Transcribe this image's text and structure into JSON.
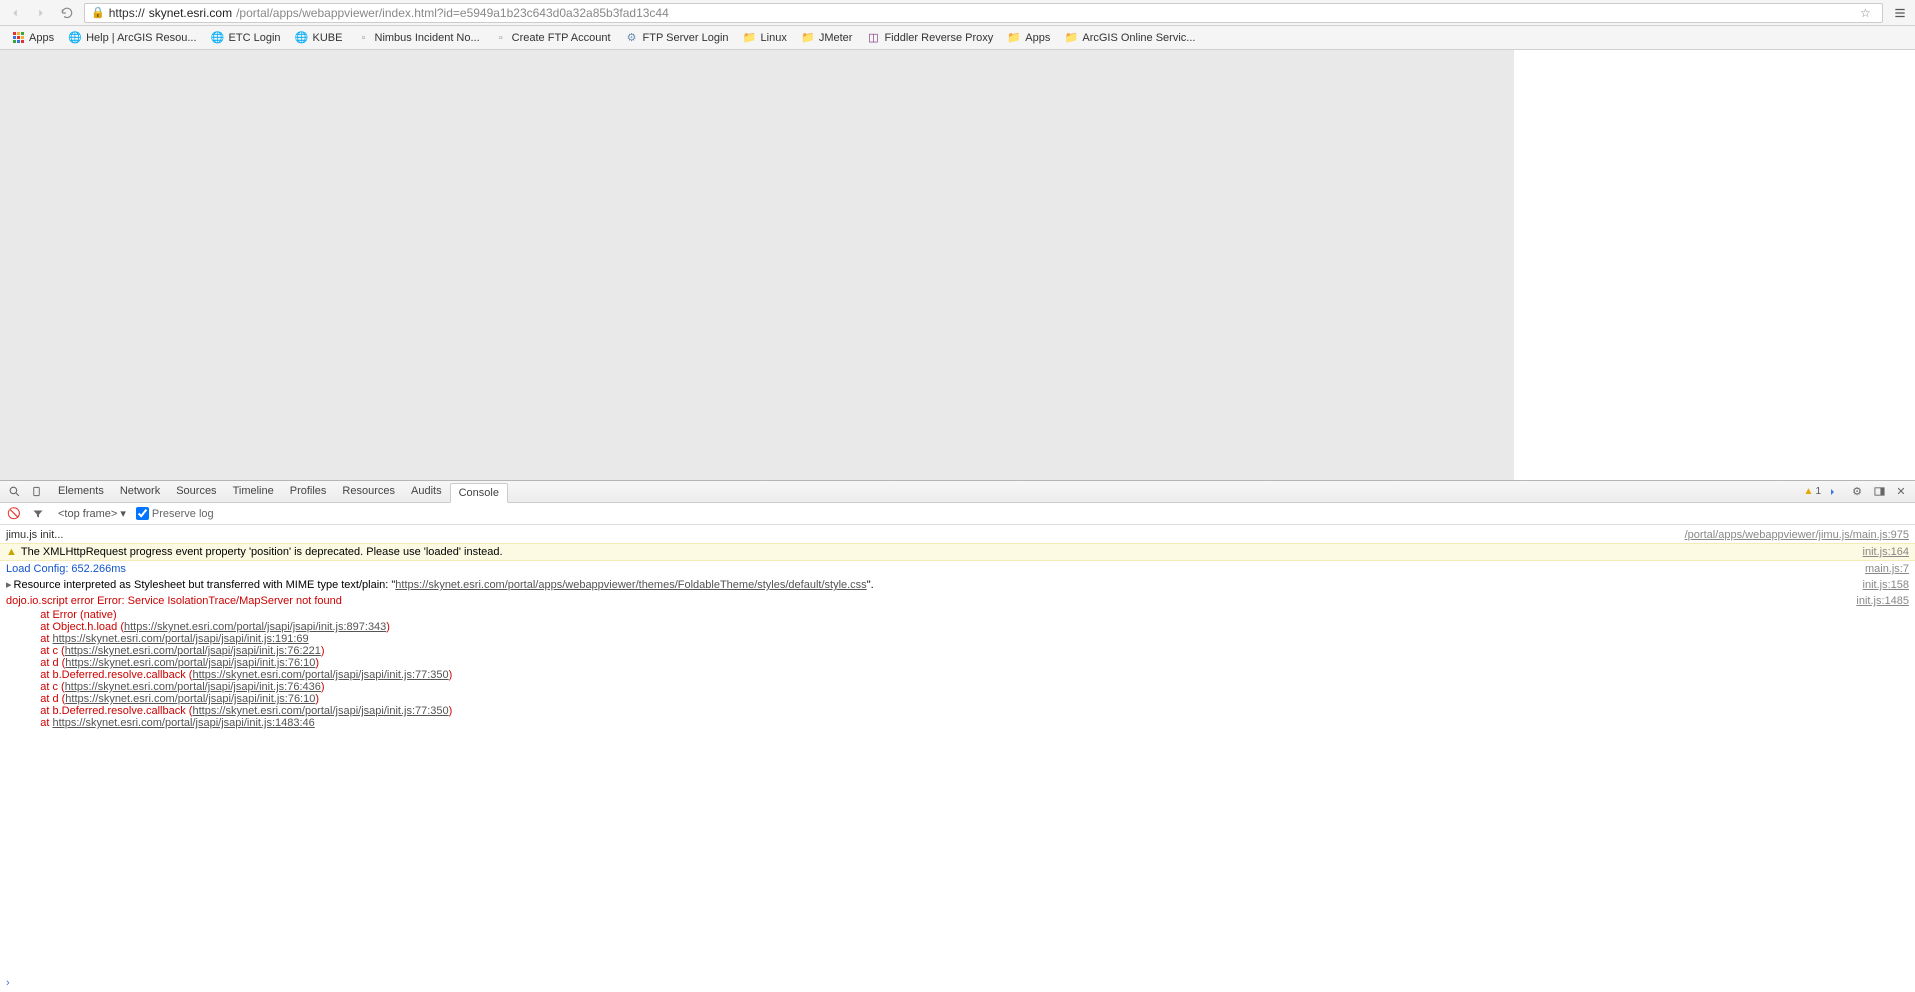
{
  "browser": {
    "url_scheme": "https://",
    "url_domain": "skynet.esri.com",
    "url_path": "/portal/apps/webappviewer/index.html?id=e5949a1b23c643d0a32a85b3fad13c44"
  },
  "bookmarks": [
    {
      "label": "Apps",
      "icon": "apps"
    },
    {
      "label": "Help | ArcGIS Resou...",
      "icon": "globe"
    },
    {
      "label": "ETC Login",
      "icon": "globe"
    },
    {
      "label": "KUBE",
      "icon": "globe"
    },
    {
      "label": "Nimbus Incident No...",
      "icon": "page"
    },
    {
      "label": "Create FTP Account",
      "icon": "page"
    },
    {
      "label": "FTP Server Login",
      "icon": "gear"
    },
    {
      "label": "Linux",
      "icon": "folder"
    },
    {
      "label": "JMeter",
      "icon": "folder"
    },
    {
      "label": "Fiddler Reverse Proxy",
      "icon": "note"
    },
    {
      "label": "Apps",
      "icon": "folder"
    },
    {
      "label": "ArcGIS Online Servic...",
      "icon": "folder"
    }
  ],
  "devtools": {
    "tabs": [
      "Elements",
      "Network",
      "Sources",
      "Timeline",
      "Profiles",
      "Resources",
      "Audits",
      "Console"
    ],
    "active_tab": "Console",
    "warning_count": "1",
    "frame_label": "<top frame>",
    "preserve_log_label": "Preserve log",
    "preserve_log_checked": true
  },
  "console": {
    "lines": [
      {
        "type": "info",
        "text": "jimu.js init...",
        "src": "/portal/apps/webappviewer/jimu.js/main.js:975"
      },
      {
        "type": "warn",
        "text": "The XMLHttpRequest progress event property 'position' is deprecated. Please use 'loaded' instead.",
        "src": "init.js:164"
      },
      {
        "type": "debug",
        "text": "Load Config: 652.266ms",
        "src": "main.js:7"
      },
      {
        "type": "res",
        "text_prefix": "Resource interpreted as Stylesheet but transferred with MIME type text/plain: \"",
        "link": "https://skynet.esri.com/portal/apps/webappviewer/themes/FoldableTheme/styles/default/style.css",
        "text_suffix": "\".",
        "src": "init.js:158"
      }
    ],
    "error": {
      "head": "dojo.io.script error Error: Service IsolationTrace/MapServer not found",
      "src": "init.js:1485",
      "stack": [
        {
          "pre": "    at Error (native)"
        },
        {
          "pre": "    at Object.h.load (",
          "link": "https://skynet.esri.com/portal/jsapi/jsapi/init.js:897:343",
          "post": ")"
        },
        {
          "pre": "    at ",
          "link": "https://skynet.esri.com/portal/jsapi/jsapi/init.js:191:69",
          "post": ""
        },
        {
          "pre": "    at c (",
          "link": "https://skynet.esri.com/portal/jsapi/jsapi/init.js:76:221",
          "post": ")"
        },
        {
          "pre": "    at d (",
          "link": "https://skynet.esri.com/portal/jsapi/jsapi/init.js:76:10",
          "post": ")"
        },
        {
          "pre": "    at b.Deferred.resolve.callback (",
          "link": "https://skynet.esri.com/portal/jsapi/jsapi/init.js:77:350",
          "post": ")"
        },
        {
          "pre": "    at c (",
          "link": "https://skynet.esri.com/portal/jsapi/jsapi/init.js:76:436",
          "post": ")"
        },
        {
          "pre": "    at d (",
          "link": "https://skynet.esri.com/portal/jsapi/jsapi/init.js:76:10",
          "post": ")"
        },
        {
          "pre": "    at b.Deferred.resolve.callback (",
          "link": "https://skynet.esri.com/portal/jsapi/jsapi/init.js:77:350",
          "post": ")"
        },
        {
          "pre": "    at ",
          "link": "https://skynet.esri.com/portal/jsapi/jsapi/init.js:1483:46",
          "post": ""
        }
      ]
    }
  }
}
